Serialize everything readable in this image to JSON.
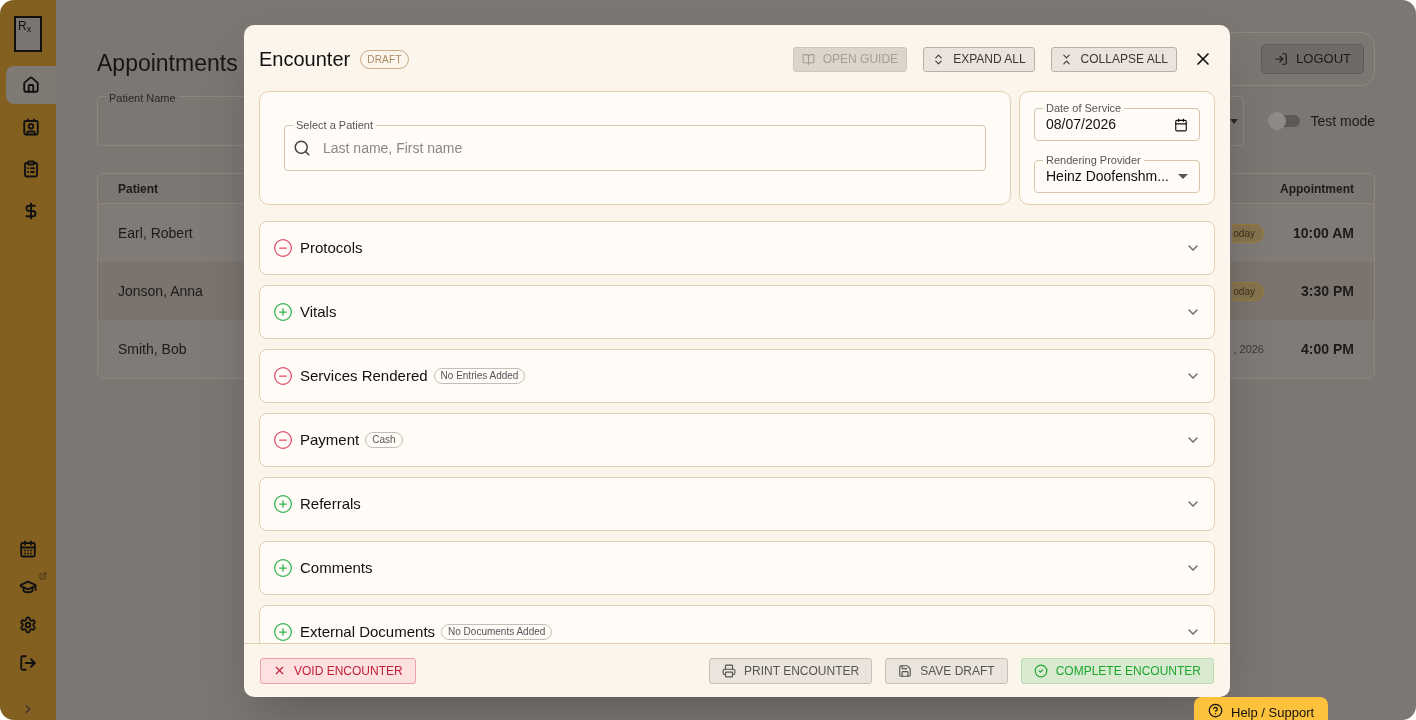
{
  "sidebar": {
    "logo": "R$_{x}$",
    "items": [
      {
        "selected": true
      },
      {
        "selected": false
      },
      {
        "selected": false
      },
      {
        "selected": false
      }
    ]
  },
  "page": {
    "title": "Appointments",
    "filter_label": "Patient Name",
    "test_mode": {
      "label": "Test mode",
      "on": false
    },
    "logout": "LOGOUT",
    "table": {
      "columns": [
        "Patient",
        "Appointment"
      ],
      "rows": [
        {
          "patient": "Earl, Robert",
          "badge": "oday",
          "time": "10:00 AM"
        },
        {
          "patient": "Jonson, Anna",
          "badge": "oday",
          "time": "3:30 PM"
        },
        {
          "patient": "Smith, Bob",
          "date": ", 2026",
          "time": "4:00 PM"
        }
      ]
    }
  },
  "modal": {
    "title": "Encounter",
    "status": "DRAFT",
    "toolbar": [
      {
        "label": "OPEN GUIDE",
        "disabled": true
      },
      {
        "label": "EXPAND ALL",
        "disabled": false
      },
      {
        "label": "COLLAPSE ALL",
        "disabled": false
      }
    ],
    "patient": {
      "label": "Select a Patient",
      "placeholder": "Last name, First name"
    },
    "date_of_service": {
      "label": "Date of Service",
      "value": "08/07/2026"
    },
    "provider": {
      "label": "Rendering Provider",
      "value": "Heinz Doofenshm..."
    },
    "sections": [
      {
        "title": "Protocols",
        "kind": "minus"
      },
      {
        "title": "Vitals",
        "kind": "plus"
      },
      {
        "title": "Services Rendered",
        "kind": "minus",
        "badge": "No Entries Added"
      },
      {
        "title": "Payment",
        "kind": "minus",
        "badge": "Cash"
      },
      {
        "title": "Referrals",
        "kind": "plus"
      },
      {
        "title": "Comments",
        "kind": "plus"
      },
      {
        "title": "External Documents",
        "kind": "plus",
        "badge": "No Documents Added"
      }
    ],
    "footer": {
      "void": "VOID ENCOUNTER",
      "print": "PRINT ENCOUNTER",
      "save": "SAVE DRAFT",
      "complete": "COMPLETE ENCOUNTER"
    }
  },
  "help": "Help / Support"
}
